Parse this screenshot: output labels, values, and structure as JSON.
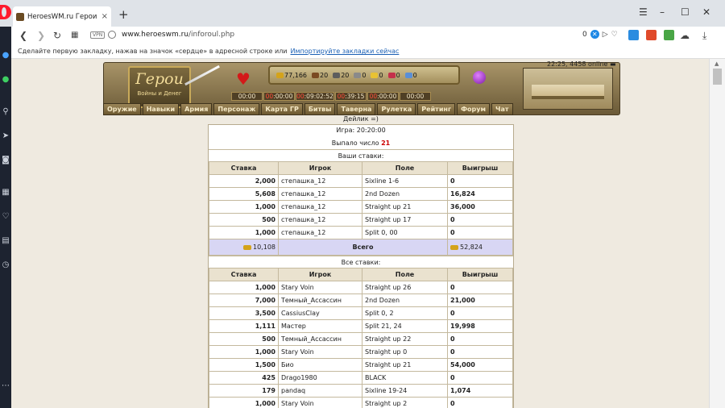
{
  "browser": {
    "tab_title": "HeroesWM.ru Герои войн",
    "tab_close": "×",
    "new_tab": "+",
    "url_host": "www.heroeswm.ru",
    "url_path": "/inforoul.php",
    "vpn_label": "VPN",
    "addr_count": "0",
    "bookmarks_hint": "Сделайте первую закладку, нажав на значок «сердце» в адресной строке или",
    "bookmarks_link": "Импортируйте закладки сейчас"
  },
  "game": {
    "logo_big": "Герои",
    "logo_small": "Войны и Денег",
    "resources": [
      {
        "icon": "gold-icon",
        "value": "77,166",
        "color": "#d4a31a"
      },
      {
        "icon": "wood-icon",
        "value": "20",
        "color": "#7b4a22"
      },
      {
        "icon": "ore-icon",
        "value": "20",
        "color": "#5d5d5d"
      },
      {
        "icon": "mercury-icon",
        "value": "0",
        "color": "#8a8a8a"
      },
      {
        "icon": "sulfur-icon",
        "value": "0",
        "color": "#e8c233"
      },
      {
        "icon": "crystal-icon",
        "value": "0",
        "color": "#c5304b"
      },
      {
        "icon": "gems-icon",
        "value": "0",
        "color": "#5a8fd6"
      }
    ],
    "timers": [
      {
        "prefix": "",
        "value": "00:00"
      },
      {
        "prefix": "00",
        "value": ":00:00"
      },
      {
        "prefix": "00",
        "value": ":09:02:52"
      },
      {
        "prefix": "00",
        "value": ":39:15"
      },
      {
        "prefix": "00",
        "value": ":00:00"
      },
      {
        "prefix": "",
        "value": "00:00"
      }
    ],
    "online": "22:25, 4458 online",
    "menu": [
      "Оружие",
      "Навыки",
      "Армия",
      "Персонаж",
      "Карта ГР",
      "Битвы",
      "Таверна",
      "Рулетка",
      "Рейтинг",
      "Форум",
      "Чат"
    ]
  },
  "roulette": {
    "dealer": "Дейлик =)",
    "game_time": "Игра: 20:20:00",
    "result_label": "Выпало число",
    "result_number": "21",
    "your_bets_title": "Ваши ставки:",
    "all_bets_title": "Все ставки:",
    "columns": [
      "Ставка",
      "Игрок",
      "Поле",
      "Выигрыш"
    ],
    "your_bets": [
      {
        "stake": "2,000",
        "player": "степашка_12",
        "field": "Sixline 1-6",
        "win": "0"
      },
      {
        "stake": "5,608",
        "player": "степашка_12",
        "field": "2nd Dozen",
        "win": "16,824"
      },
      {
        "stake": "1,000",
        "player": "степашка_12",
        "field": "Straight up 21",
        "win": "36,000"
      },
      {
        "stake": "500",
        "player": "степашка_12",
        "field": "Straight up 17",
        "win": "0"
      },
      {
        "stake": "1,000",
        "player": "степашка_12",
        "field": "Split 0, 00",
        "win": "0"
      }
    ],
    "total": {
      "stake": "10,108",
      "label": "Всего",
      "win": "52,824"
    },
    "all_bets": [
      {
        "stake": "1,000",
        "player": "Stary Voin",
        "field": "Straight up 26",
        "win": "0"
      },
      {
        "stake": "7,000",
        "player": "Темный_Ассассин",
        "field": "2nd Dozen",
        "win": "21,000"
      },
      {
        "stake": "3,500",
        "player": "CassiusClay",
        "field": "Split 0, 2",
        "win": "0"
      },
      {
        "stake": "1,111",
        "player": "Мастер",
        "field": "Split 21, 24",
        "win": "19,998"
      },
      {
        "stake": "500",
        "player": "Темный_Ассассин",
        "field": "Straight up 22",
        "win": "0"
      },
      {
        "stake": "1,000",
        "player": "Stary Voin",
        "field": "Straight up 0",
        "win": "0"
      },
      {
        "stake": "1,500",
        "player": "Био",
        "field": "Straight up 21",
        "win": "54,000"
      },
      {
        "stake": "425",
        "player": "Drago1980",
        "field": "BLACK",
        "win": "0"
      },
      {
        "stake": "179",
        "player": "pandaq",
        "field": "Sixline 19-24",
        "win": "1,074"
      },
      {
        "stake": "1,000",
        "player": "Stary Voin",
        "field": "Straight up 2",
        "win": "0"
      }
    ]
  }
}
